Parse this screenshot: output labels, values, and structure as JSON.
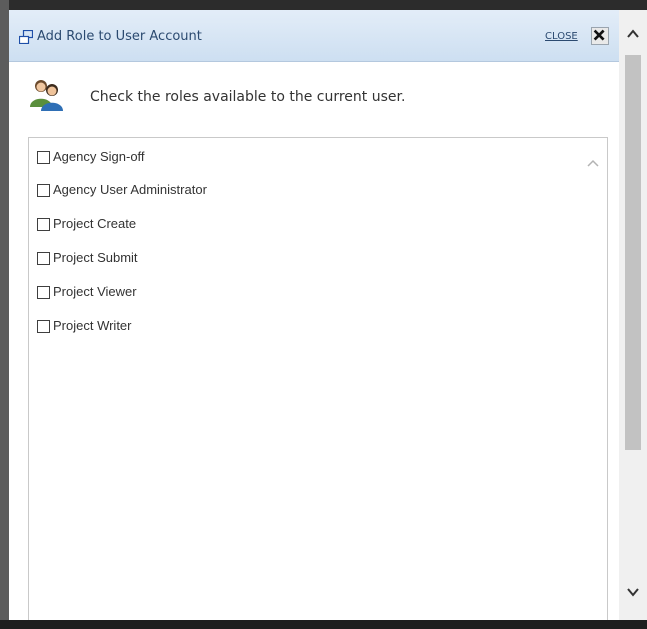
{
  "dialog": {
    "title": "Add Role to User Account",
    "close_label": "CLOSE",
    "instruction": "Check the roles available to the current user."
  },
  "roles": [
    {
      "label": "Agency Sign-off",
      "checked": false
    },
    {
      "label": "Agency User Administrator",
      "checked": false
    },
    {
      "label": "Project Create",
      "checked": false
    },
    {
      "label": "Project Submit",
      "checked": false
    },
    {
      "label": "Project Viewer",
      "checked": false
    },
    {
      "label": "Project Writer",
      "checked": false
    }
  ],
  "icons": {
    "title": "new-window-icon",
    "close": "close-x-icon",
    "instruction": "users-icon",
    "scroll_up": "chevron-up-icon",
    "scroll_down": "chevron-down-icon"
  },
  "colors": {
    "title_text": "#2b4a70",
    "titlebar_gradient_top": "#e3edf8",
    "titlebar_gradient_bottom": "#cddff1",
    "title_icon": "#1f4fa8"
  }
}
